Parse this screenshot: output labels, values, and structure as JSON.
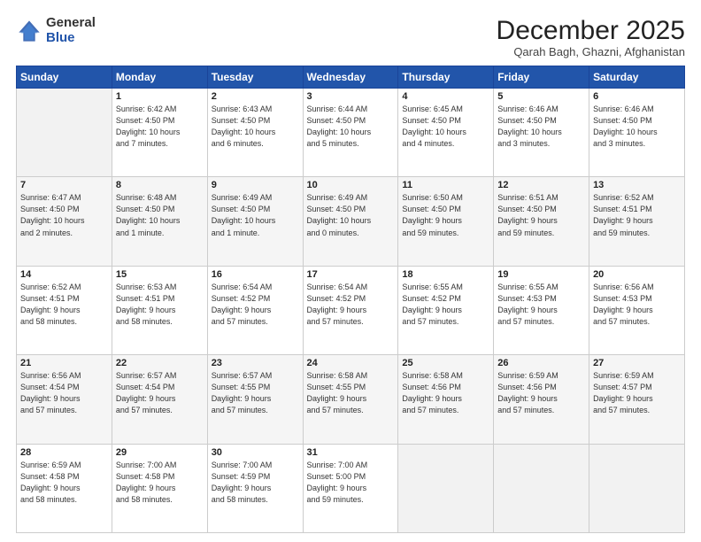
{
  "header": {
    "logo_general": "General",
    "logo_blue": "Blue",
    "month_title": "December 2025",
    "subtitle": "Qarah Bagh, Ghazni, Afghanistan"
  },
  "calendar": {
    "days_of_week": [
      "Sunday",
      "Monday",
      "Tuesday",
      "Wednesday",
      "Thursday",
      "Friday",
      "Saturday"
    ],
    "weeks": [
      [
        {
          "day": "",
          "info": ""
        },
        {
          "day": "1",
          "info": "Sunrise: 6:42 AM\nSunset: 4:50 PM\nDaylight: 10 hours\nand 7 minutes."
        },
        {
          "day": "2",
          "info": "Sunrise: 6:43 AM\nSunset: 4:50 PM\nDaylight: 10 hours\nand 6 minutes."
        },
        {
          "day": "3",
          "info": "Sunrise: 6:44 AM\nSunset: 4:50 PM\nDaylight: 10 hours\nand 5 minutes."
        },
        {
          "day": "4",
          "info": "Sunrise: 6:45 AM\nSunset: 4:50 PM\nDaylight: 10 hours\nand 4 minutes."
        },
        {
          "day": "5",
          "info": "Sunrise: 6:46 AM\nSunset: 4:50 PM\nDaylight: 10 hours\nand 3 minutes."
        },
        {
          "day": "6",
          "info": "Sunrise: 6:46 AM\nSunset: 4:50 PM\nDaylight: 10 hours\nand 3 minutes."
        }
      ],
      [
        {
          "day": "7",
          "info": "Sunrise: 6:47 AM\nSunset: 4:50 PM\nDaylight: 10 hours\nand 2 minutes."
        },
        {
          "day": "8",
          "info": "Sunrise: 6:48 AM\nSunset: 4:50 PM\nDaylight: 10 hours\nand 1 minute."
        },
        {
          "day": "9",
          "info": "Sunrise: 6:49 AM\nSunset: 4:50 PM\nDaylight: 10 hours\nand 1 minute."
        },
        {
          "day": "10",
          "info": "Sunrise: 6:49 AM\nSunset: 4:50 PM\nDaylight: 10 hours\nand 0 minutes."
        },
        {
          "day": "11",
          "info": "Sunrise: 6:50 AM\nSunset: 4:50 PM\nDaylight: 9 hours\nand 59 minutes."
        },
        {
          "day": "12",
          "info": "Sunrise: 6:51 AM\nSunset: 4:50 PM\nDaylight: 9 hours\nand 59 minutes."
        },
        {
          "day": "13",
          "info": "Sunrise: 6:52 AM\nSunset: 4:51 PM\nDaylight: 9 hours\nand 59 minutes."
        }
      ],
      [
        {
          "day": "14",
          "info": "Sunrise: 6:52 AM\nSunset: 4:51 PM\nDaylight: 9 hours\nand 58 minutes."
        },
        {
          "day": "15",
          "info": "Sunrise: 6:53 AM\nSunset: 4:51 PM\nDaylight: 9 hours\nand 58 minutes."
        },
        {
          "day": "16",
          "info": "Sunrise: 6:54 AM\nSunset: 4:52 PM\nDaylight: 9 hours\nand 57 minutes."
        },
        {
          "day": "17",
          "info": "Sunrise: 6:54 AM\nSunset: 4:52 PM\nDaylight: 9 hours\nand 57 minutes."
        },
        {
          "day": "18",
          "info": "Sunrise: 6:55 AM\nSunset: 4:52 PM\nDaylight: 9 hours\nand 57 minutes."
        },
        {
          "day": "19",
          "info": "Sunrise: 6:55 AM\nSunset: 4:53 PM\nDaylight: 9 hours\nand 57 minutes."
        },
        {
          "day": "20",
          "info": "Sunrise: 6:56 AM\nSunset: 4:53 PM\nDaylight: 9 hours\nand 57 minutes."
        }
      ],
      [
        {
          "day": "21",
          "info": "Sunrise: 6:56 AM\nSunset: 4:54 PM\nDaylight: 9 hours\nand 57 minutes."
        },
        {
          "day": "22",
          "info": "Sunrise: 6:57 AM\nSunset: 4:54 PM\nDaylight: 9 hours\nand 57 minutes."
        },
        {
          "day": "23",
          "info": "Sunrise: 6:57 AM\nSunset: 4:55 PM\nDaylight: 9 hours\nand 57 minutes."
        },
        {
          "day": "24",
          "info": "Sunrise: 6:58 AM\nSunset: 4:55 PM\nDaylight: 9 hours\nand 57 minutes."
        },
        {
          "day": "25",
          "info": "Sunrise: 6:58 AM\nSunset: 4:56 PM\nDaylight: 9 hours\nand 57 minutes."
        },
        {
          "day": "26",
          "info": "Sunrise: 6:59 AM\nSunset: 4:56 PM\nDaylight: 9 hours\nand 57 minutes."
        },
        {
          "day": "27",
          "info": "Sunrise: 6:59 AM\nSunset: 4:57 PM\nDaylight: 9 hours\nand 57 minutes."
        }
      ],
      [
        {
          "day": "28",
          "info": "Sunrise: 6:59 AM\nSunset: 4:58 PM\nDaylight: 9 hours\nand 58 minutes."
        },
        {
          "day": "29",
          "info": "Sunrise: 7:00 AM\nSunset: 4:58 PM\nDaylight: 9 hours\nand 58 minutes."
        },
        {
          "day": "30",
          "info": "Sunrise: 7:00 AM\nSunset: 4:59 PM\nDaylight: 9 hours\nand 58 minutes."
        },
        {
          "day": "31",
          "info": "Sunrise: 7:00 AM\nSunset: 5:00 PM\nDaylight: 9 hours\nand 59 minutes."
        },
        {
          "day": "",
          "info": ""
        },
        {
          "day": "",
          "info": ""
        },
        {
          "day": "",
          "info": ""
        }
      ]
    ]
  }
}
